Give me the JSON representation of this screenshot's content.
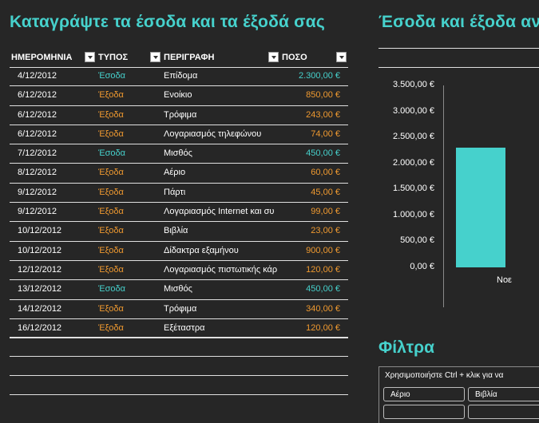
{
  "sheet": {
    "title": "Καταγράψτε τα έσοδα και τα έξοδά σας",
    "columns": [
      "ΗΜΕΡΟΜΗΝΙΑ",
      "ΤΥΠΟΣ",
      "ΠΕΡΙΓΡΑΦΗ",
      "ΠΟΣΟ"
    ],
    "rows": [
      {
        "date": "4/12/2012",
        "type": "Έσοδα",
        "desc": "Επίδομα",
        "amount": "2.300,00 €"
      },
      {
        "date": "6/12/2012",
        "type": "Έξοδα",
        "desc": "Ενοίκιο",
        "amount": "850,00 €"
      },
      {
        "date": "6/12/2012",
        "type": "Έξοδα",
        "desc": "Τρόφιμα",
        "amount": "243,00 €"
      },
      {
        "date": "6/12/2012",
        "type": "Έξοδα",
        "desc": "Λογαριασμός τηλεφώνου",
        "amount": "74,00 €"
      },
      {
        "date": "7/12/2012",
        "type": "Έσοδα",
        "desc": "Μισθός",
        "amount": "450,00 €"
      },
      {
        "date": "8/12/2012",
        "type": "Έξοδα",
        "desc": "Αέριο",
        "amount": "60,00 €"
      },
      {
        "date": "9/12/2012",
        "type": "Έξοδα",
        "desc": "Πάρτι",
        "amount": "45,00 €"
      },
      {
        "date": "9/12/2012",
        "type": "Έξοδα",
        "desc": "Λογαριασμός Internet και συ",
        "amount": "99,00 €"
      },
      {
        "date": "10/12/2012",
        "type": "Έξοδα",
        "desc": "Βιβλία",
        "amount": "23,00 €"
      },
      {
        "date": "10/12/2012",
        "type": "Έξοδα",
        "desc": "Δίδακτρα εξαμήνου",
        "amount": "900,00 €"
      },
      {
        "date": "12/12/2012",
        "type": "Έξοδα",
        "desc": "Λογαριασμός πιστωτικής κάρ",
        "amount": "120,00 €"
      },
      {
        "date": "13/12/2012",
        "type": "Έσοδα",
        "desc": "Μισθός",
        "amount": "450,00 €"
      },
      {
        "date": "14/12/2012",
        "type": "Έξοδα",
        "desc": "Τρόφιμα",
        "amount": "340,00 €"
      },
      {
        "date": "16/12/2012",
        "type": "Έξοδα",
        "desc": "Εξέταστρα",
        "amount": "120,00 €"
      }
    ]
  },
  "chart_data": {
    "type": "bar",
    "title": "Έσοδα και έξοδα ανά",
    "categories": [
      "Νοε"
    ],
    "values": [
      2300
    ],
    "ylim": [
      0,
      3500
    ],
    "yticks": [
      "3.500,00 €",
      "3.000,00 €",
      "2.500,00 €",
      "2.000,00 €",
      "1.500,00 €",
      "1.000,00 €",
      "500,00 €",
      "0,00 €"
    ],
    "bar_color": "#46d1cc"
  },
  "filters": {
    "title": "Φίλτρα",
    "hint": "Χρησιμοποιήστε Ctrl + κλικ για να",
    "buttons": [
      "Αέριο",
      "Βιβλία",
      "",
      ""
    ]
  },
  "colors": {
    "accent": "#46d1cc",
    "expense": "#f09a30",
    "background": "#262626"
  }
}
